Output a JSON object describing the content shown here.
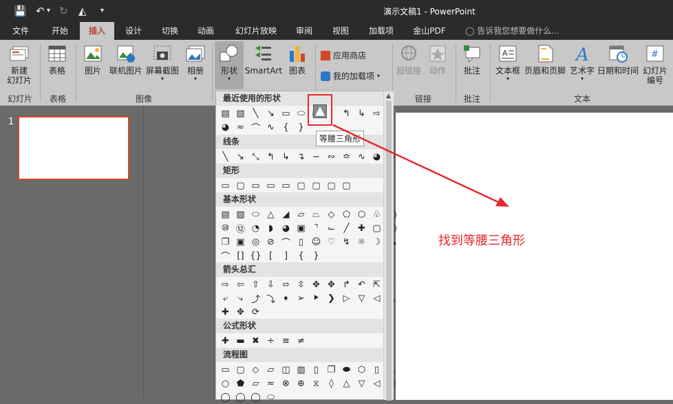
{
  "window": {
    "title": "演示文稿1 - PowerPoint"
  },
  "tabs": [
    {
      "label": "文件",
      "active": false
    },
    {
      "label": "开始",
      "active": false
    },
    {
      "label": "插入",
      "active": true
    },
    {
      "label": "设计",
      "active": false
    },
    {
      "label": "切换",
      "active": false
    },
    {
      "label": "动画",
      "active": false
    },
    {
      "label": "幻灯片放映",
      "active": false
    },
    {
      "label": "审阅",
      "active": false
    },
    {
      "label": "视图",
      "active": false
    },
    {
      "label": "加载项",
      "active": false
    },
    {
      "label": "金山PDF",
      "active": false
    }
  ],
  "tell_me": "告诉我您想要做什么...",
  "ribbon": {
    "new_slide": "新建\n幻灯片",
    "table": "表格",
    "picture": "图片",
    "online_picture": "联机图片",
    "screenshot": "屏幕截图",
    "album": "相册",
    "shapes": "形状",
    "smartart": "SmartArt",
    "chart": "图表",
    "store": "应用商店",
    "my_addins": "我的加载项",
    "hyperlink": "超链接",
    "action": "动作",
    "comment": "批注",
    "textbox": "文本框",
    "header_footer": "页眉和页脚",
    "wordart": "艺术字",
    "datetime": "日期和时间",
    "slide_number": "幻灯片\n编号",
    "groups": {
      "slides": "幻灯片",
      "tables": "表格",
      "images": "图像",
      "links": "链接",
      "comments": "批注",
      "text": "文本"
    }
  },
  "slide_panel": {
    "number": "1"
  },
  "gallery": {
    "sections": [
      "最近使用的形状",
      "线条",
      "矩形",
      "基本形状",
      "箭头总汇",
      "公式形状",
      "流程图"
    ],
    "tooltip": "等腰三角形"
  },
  "annotation": "找到等腰三角形",
  "colors": {
    "accent": "#b7472a",
    "highlight": "#e8272e"
  }
}
